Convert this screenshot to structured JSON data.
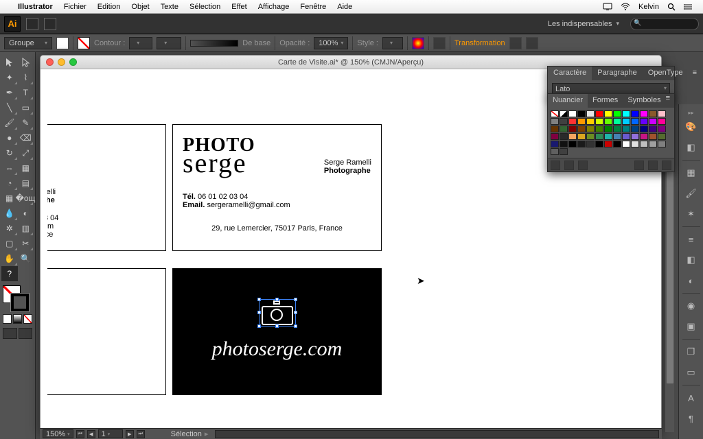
{
  "menubar": {
    "app": "Illustrator",
    "items": [
      "Fichier",
      "Edition",
      "Objet",
      "Texte",
      "Sélection",
      "Effet",
      "Affichage",
      "Fenêtre",
      "Aide"
    ],
    "user": "Kelvin"
  },
  "appbar": {
    "ai": "Ai",
    "workspace": "Les indispensables"
  },
  "control": {
    "mode": "Groupe",
    "contour_label": "Contour :",
    "contour_value": "",
    "brush_label": "De base",
    "opacity_label": "Opacité :",
    "opacity_value": "100%",
    "style_label": "Style :",
    "transform": "Transformation"
  },
  "document": {
    "title": "Carte de Visite.ai* @ 150% (CMJN/Aperçu)",
    "zoom": "150%",
    "page": "1",
    "status_tool": "Sélection"
  },
  "cards": {
    "photo": "PHOTO",
    "serge": "serge",
    "name": "Serge Ramelli",
    "job": "Photographe",
    "tel_label": "Tél.",
    "tel": "06 01 02 03 04",
    "email_label": "Email.",
    "email": "sergeramelli@gmail.com",
    "addr": "29, rue Lemercier, 75017 Paris, France",
    "city": "Paris, France",
    "url": "photoserge.com"
  },
  "char_panel": {
    "tabs": [
      "Caractère",
      "Paragraphe",
      "OpenType"
    ],
    "font": "Lato"
  },
  "swatch_panel": {
    "tabs": [
      "Nuancier",
      "Formes",
      "Symboles"
    ],
    "colors": [
      "#ffffff",
      "#000000",
      "#e6e6e6",
      "#ff0000",
      "#ffff00",
      "#00ff00",
      "#00ffff",
      "#0000ff",
      "#ff00ff",
      "#8b5a2b",
      "#ffc0cb",
      "#808080",
      "#404040",
      "#ff3333",
      "#ff9900",
      "#ffcc00",
      "#ccff00",
      "#66ff00",
      "#00ff99",
      "#00ccff",
      "#0066ff",
      "#6600ff",
      "#cc00ff",
      "#ff0099",
      "#663300",
      "#336633",
      "#800000",
      "#804000",
      "#808000",
      "#408000",
      "#008000",
      "#008040",
      "#008080",
      "#004080",
      "#000080",
      "#400080",
      "#800080",
      "#800040",
      "#2a2a2a",
      "#f4a460",
      "#daa520",
      "#6b8e23",
      "#2e8b57",
      "#20b2aa",
      "#4682b4",
      "#6a5acd",
      "#9370db",
      "#c71585",
      "#a0522d",
      "#556b2f",
      "#191970",
      "#111111",
      "#000000",
      "#1a1a1a",
      "#333333",
      "#000000",
      "#cc0000",
      "#000000",
      "#ffffff",
      "#e0e0e0",
      "#c0c0c0",
      "#a0a0a0",
      "#808080",
      "#606060",
      "#404040"
    ]
  }
}
